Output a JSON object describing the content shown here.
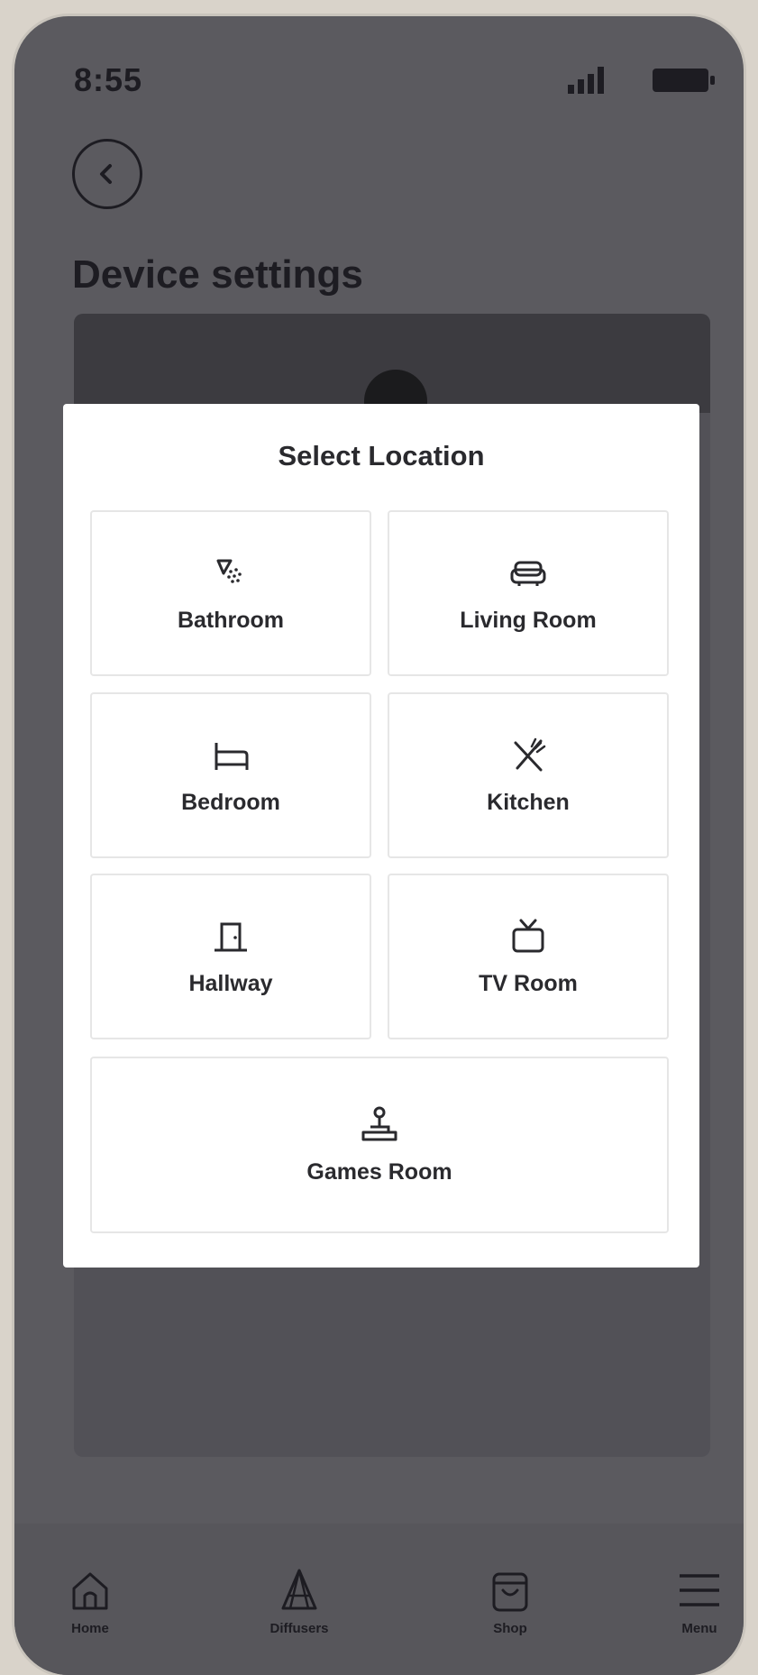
{
  "status_bar": {
    "time": "8:55"
  },
  "header": {
    "title": "Device settings"
  },
  "modal": {
    "title": "Select Location",
    "locations": [
      {
        "label": "Bathroom",
        "icon": "shower-icon"
      },
      {
        "label": "Living Room",
        "icon": "sofa-icon"
      },
      {
        "label": "Bedroom",
        "icon": "bed-icon"
      },
      {
        "label": "Kitchen",
        "icon": "utensils-icon"
      },
      {
        "label": "Hallway",
        "icon": "door-icon"
      },
      {
        "label": "TV Room",
        "icon": "tv-icon"
      },
      {
        "label": "Games Room",
        "icon": "joystick-icon"
      }
    ]
  },
  "bottom_nav": {
    "items": [
      {
        "label": "Home",
        "icon": "home-icon"
      },
      {
        "label": "Diffusers",
        "icon": "diffuser-icon"
      },
      {
        "label": "Shop",
        "icon": "shopping-bag-icon"
      },
      {
        "label": "Menu",
        "icon": "hamburger-menu-icon"
      }
    ]
  },
  "colors": {
    "overlay": "#5b5a5f",
    "modal_background": "#ffffff",
    "text_dark": "#1d1c22"
  }
}
